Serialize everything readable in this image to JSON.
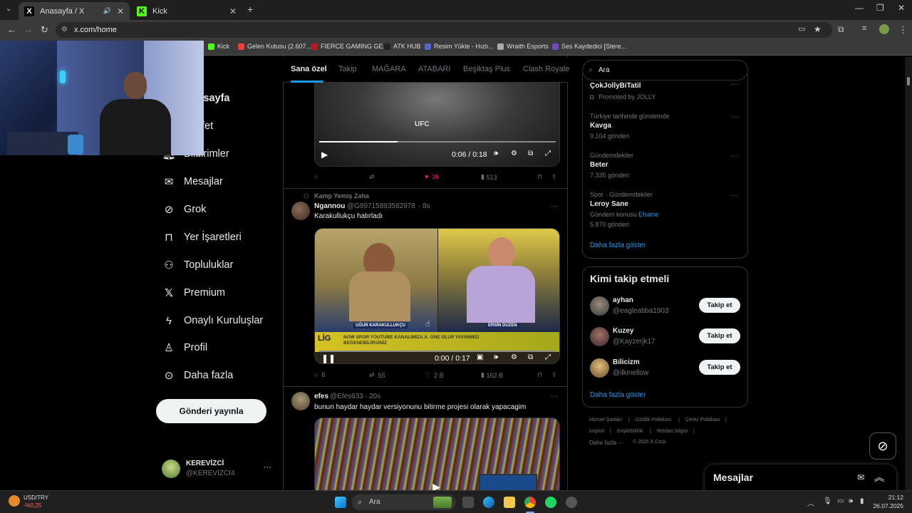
{
  "browser": {
    "tabs": [
      {
        "title": "Anasayfa / X",
        "favicon": "X"
      },
      {
        "title": "Kick",
        "favicon": "K"
      }
    ],
    "url": "x.com/home",
    "bookmarks": [
      "Kick",
      "Gelen Kutusu (2.607...",
      "FIERCE GAMING GE...",
      "ATK HUB",
      "Resim Yükle - Hızlı...",
      "Wraith Esports",
      "Ses Kaydedici [Stere..."
    ]
  },
  "nav": {
    "items": [
      {
        "label": "Anasayfa",
        "icon": "home-icon"
      },
      {
        "label": "Keşfet",
        "icon": "search-icon"
      },
      {
        "label": "Bildirimler",
        "icon": "bell-icon"
      },
      {
        "label": "Mesajlar",
        "icon": "mail-icon"
      },
      {
        "label": "Grok",
        "icon": "grok-icon"
      },
      {
        "label": "Yer İşaretleri",
        "icon": "bookmark-icon"
      },
      {
        "label": "Topluluklar",
        "icon": "communities-icon"
      },
      {
        "label": "Premium",
        "icon": "x-logo-icon"
      },
      {
        "label": "Onaylı Kuruluşlar",
        "icon": "lightning-icon"
      },
      {
        "label": "Profil",
        "icon": "person-icon"
      },
      {
        "label": "Daha fazla",
        "icon": "more-circle-icon"
      }
    ],
    "post_button": "Gönderi yayınla",
    "account": {
      "name": "KEREVİZCİ",
      "handle": "@KEREVIZCI4"
    }
  },
  "center": {
    "tabs": [
      "Sana özel",
      "Takip",
      "MAĞARA",
      "ATABARI",
      "Beşiktaş Plus",
      "Clash Royale"
    ],
    "post1": {
      "video_time": "0:06 / 0:18",
      "video_progress": 0.33,
      "likes": "36",
      "views": "513"
    },
    "post2": {
      "context": "Kamp Yemiş Zaha",
      "name": "Ngannou",
      "handle": "@G89715893582978",
      "time": "8s",
      "text": "Karakullukçu hatırladı",
      "video_time": "0:00 / 0:17",
      "video_progress": 0,
      "caption_left": "UĞUR KARAKULLUKÇU",
      "caption_right": "ERSİN DÜZEN",
      "banner": "LİG",
      "banner_text": "NOW SPOR YOUTUBE KANALIMIZA A. ONE OLUP YAYINIMIZI BEĞENEBİLİRSİNİZ",
      "replies": "6",
      "reposts": "55",
      "likes": "2 B",
      "views": "162 B"
    },
    "post3": {
      "name": "efes",
      "handle": "@Efes633",
      "time": "20s",
      "text": "bunun haydar haydar versiyonunu bitirme projesi olarak yapacagim"
    }
  },
  "right": {
    "search_placeholder": "Ara",
    "trends": [
      {
        "title": "ÇokJollyBiTatil",
        "sub": "Promoted by JOLLY"
      },
      {
        "context": "Türkiye tarihinde gündemde",
        "title": "Kavga",
        "count": "9.104 gönderi"
      },
      {
        "context": "Gündemdekiler",
        "title": "Beter",
        "count": "7.335 gönderi"
      },
      {
        "context": "Spor · Gündemdekiler",
        "title": "Leroy Sane",
        "topic_prefix": "Gündem konusu",
        "topic": "Efsane",
        "count": "5.870 gönderi"
      }
    ],
    "trends_more": "Daha fazla göster",
    "who_to_follow_title": "Kimi takip etmeli",
    "who_to_follow": [
      {
        "name": "ayhan",
        "handle": "@eagleatiba1903"
      },
      {
        "name": "Kuzey",
        "handle": "@Kayzerjk17"
      },
      {
        "name": "Bilicizm",
        "handle": "@ilkinellow"
      }
    ],
    "follow_label": "Takip et",
    "follow_more": "Daha fazla göster",
    "footer": [
      "Hizmet Şartları",
      "Gizlilik Politikası",
      "Çerez Politikası",
      "Imprint",
      "Erişilebilirlik",
      "Reklam bilgisi",
      "Daha fazla ···",
      "© 2025 X Corp."
    ],
    "messages_label": "Mesajlar"
  },
  "taskbar": {
    "currency": "USD/TRY",
    "change": "-%0,25",
    "search": "Ara",
    "time": "21:12",
    "date": "26.07.2025"
  },
  "colors": {
    "accent": "#1d9bf0",
    "like": "#f91880",
    "background": "#000000"
  }
}
